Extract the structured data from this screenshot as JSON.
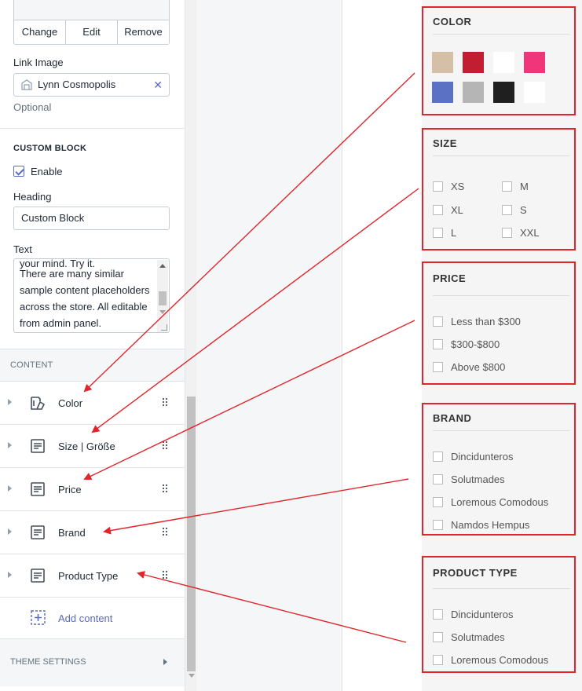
{
  "image_picker": {
    "actions": [
      "Change",
      "Edit",
      "Remove"
    ]
  },
  "link_image": {
    "label": "Link Image",
    "value": "Lynn Cosmopolis",
    "clear_icon": "close-icon",
    "hint": "Optional"
  },
  "custom_block": {
    "section_title": "CUSTOM BLOCK",
    "enable_label": "Enable",
    "enable_checked": true,
    "heading_label": "Heading",
    "heading_value": "Custom Block",
    "text_label": "Text",
    "text_cut_line": "your mind. Try it.",
    "text_value": "There are many similar sample content placeholders across the store. All editable from admin panel."
  },
  "content": {
    "header": "CONTENT",
    "blocks": [
      {
        "label": "Color",
        "icon": "color-swatch-icon"
      },
      {
        "label": "Size | Größe",
        "icon": "text-block-icon"
      },
      {
        "label": "Price",
        "icon": "text-block-icon"
      },
      {
        "label": "Brand",
        "icon": "text-block-icon"
      },
      {
        "label": "Product Type",
        "icon": "text-block-icon"
      }
    ],
    "add_label": "Add content"
  },
  "theme_settings": {
    "label": "THEME SETTINGS"
  },
  "filters": {
    "color": {
      "title": "COLOR",
      "swatches": [
        "#d5bfa6",
        "#c21d30",
        "#ffffff",
        "#f0357a",
        "#5b72c4",
        "#b5b5b5",
        "#1f1f1f",
        "#ffffff"
      ]
    },
    "size": {
      "title": "SIZE",
      "options": [
        "XS",
        "M",
        "XL",
        "S",
        "L",
        "XXL"
      ]
    },
    "price": {
      "title": "PRICE",
      "options": [
        "Less than $300",
        "$300-$800",
        "Above $800"
      ]
    },
    "brand": {
      "title": "BRAND",
      "options": [
        "Dincidunteros",
        "Solutmades",
        "Loremous Comodous",
        "Namdos Hempus"
      ]
    },
    "product_type": {
      "title": "PRODUCT TYPE",
      "options": [
        "Dincidunteros",
        "Solutmades",
        "Loremous Comodous"
      ]
    }
  },
  "colors": {
    "annotation_red": "#e0252b",
    "accent": "#5c6ac4"
  }
}
